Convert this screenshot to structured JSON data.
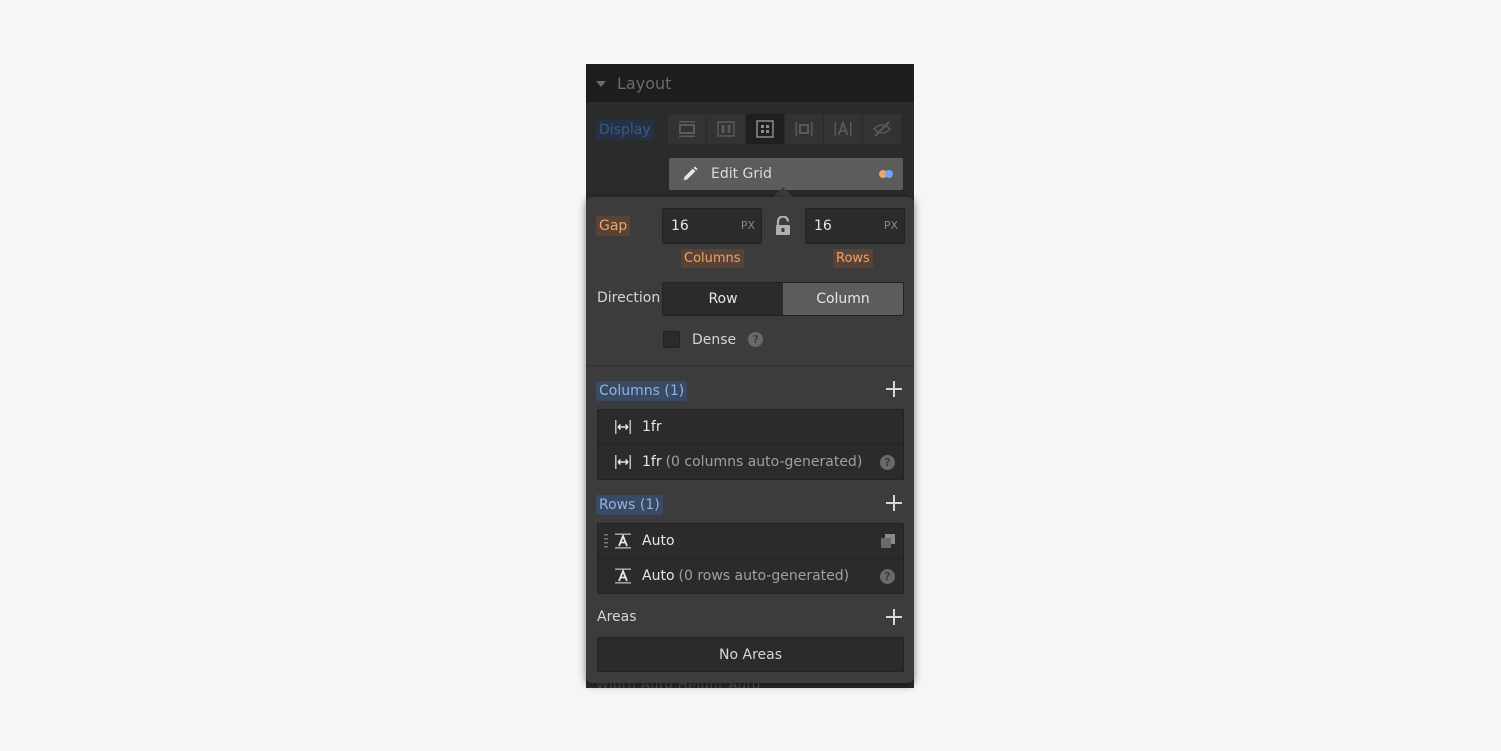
{
  "section": {
    "title": "Layout"
  },
  "display": {
    "label": "Display",
    "options": [
      {
        "name": "block",
        "active": false
      },
      {
        "name": "flex",
        "active": false
      },
      {
        "name": "grid",
        "active": true
      },
      {
        "name": "inline-block",
        "active": false
      },
      {
        "name": "inline",
        "active": false
      },
      {
        "name": "none",
        "active": false
      }
    ],
    "edit_grid_label": "Edit Grid",
    "indicator_colors": [
      "#e8a56f",
      "#6aa8ff"
    ]
  },
  "gap": {
    "label": "Gap",
    "columns_value": "16",
    "columns_unit": "PX",
    "rows_value": "16",
    "rows_unit": "PX",
    "columns_label": "Columns",
    "rows_label": "Rows"
  },
  "direction": {
    "label": "Direction",
    "options": [
      "Row",
      "Column"
    ],
    "selected": "Column"
  },
  "dense": {
    "label": "Dense",
    "checked": false
  },
  "columns": {
    "title": "Columns (1)",
    "items": [
      {
        "value": "1fr",
        "note": ""
      },
      {
        "value": "1fr",
        "note": "(0 columns auto-generated)"
      }
    ]
  },
  "rows": {
    "title": "Rows (1)",
    "items": [
      {
        "value": "Auto",
        "note": ""
      },
      {
        "value": "Auto",
        "note": "(0 rows auto-generated)"
      }
    ]
  },
  "areas": {
    "title": "Areas",
    "empty_label": "No Areas"
  },
  "background_text": "Width    Auto    Height    Auto",
  "colors": {
    "accent_orange": "#e8a56f",
    "accent_blue": "#8fb4e6"
  }
}
